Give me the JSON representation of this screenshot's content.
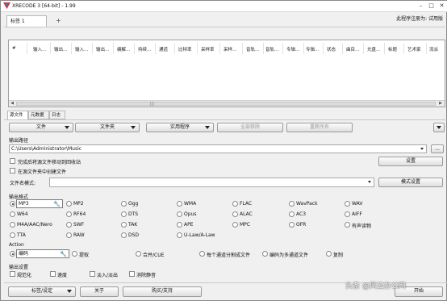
{
  "window": {
    "title": "XRECODE 3 [64-bit] - 1.99",
    "license_text": "此程序注册为: 试用版",
    "buttons": {
      "minimize": "–",
      "maximize": "□",
      "close": "✕"
    }
  },
  "tabs": {
    "main_tab": "标签 1",
    "add_tab": "+"
  },
  "columns": [
    "#",
    "输入...",
    "输出...",
    "输入...",
    "输出...",
    "编解...",
    "持续...",
    "通道",
    "比特率",
    "采样率",
    "采样...",
    "音轨...",
    "音轨...",
    "专辑...",
    "专辑...",
    "状态",
    "曲目...",
    "光盘...",
    "标题",
    "艺术家",
    "流派"
  ],
  "scroll_grip": "|||",
  "lower_tabs": [
    "源文件",
    "元数据",
    "日志"
  ],
  "toolbar": {
    "file_label": "文件",
    "folder_label": "文件夹",
    "apps_label": "实用程序",
    "remove_all_label": "全部移除",
    "reset_all_label": "重新所有"
  },
  "output": {
    "path_label": "输出路径",
    "path_value": "C:\\Users\\Administrator\\Music",
    "browse_label": "...",
    "move_to_recycle_label": "完成后将源文件移动到回收站",
    "create_in_folder_label": "在源文件夹中创建文件",
    "settings_label": "设置",
    "filename_mode_label": "文件名模式:",
    "mode_settings_label": "模式设置"
  },
  "formats": {
    "section_label": "输出格式",
    "items": [
      [
        "MP3",
        "MP2",
        "Ogg",
        "WMA",
        "FLAC",
        "WavPack",
        "WAV"
      ],
      [
        "W64",
        "RF64",
        "DTS",
        "Opus",
        "ALAC",
        "AC3",
        "AIFF"
      ],
      [
        "M4A/AAC/Nero",
        "SWF",
        "TAK",
        "APE",
        "MPC",
        "OFR",
        "有声读物"
      ],
      [
        "TTA",
        "RAW",
        "DSD",
        "U-Law/A-Law"
      ]
    ],
    "selected": "MP3"
  },
  "action": {
    "section_label": "Action",
    "items": [
      "编码",
      "提取",
      "合并/CUE",
      "每个通道分割成文件",
      "编码为多通道文件",
      "复制"
    ],
    "selected": "编码"
  },
  "output_settings": {
    "section_label": "输出设置",
    "items": [
      "规范化",
      "速度",
      "淡入/淡出",
      "消除静音"
    ]
  },
  "footer": {
    "tags_label": "标签/设定",
    "about_label": "关于",
    "buy_label": "购买/支持",
    "start_label": "开始"
  },
  "watermark": "头条 @风云办公网"
}
